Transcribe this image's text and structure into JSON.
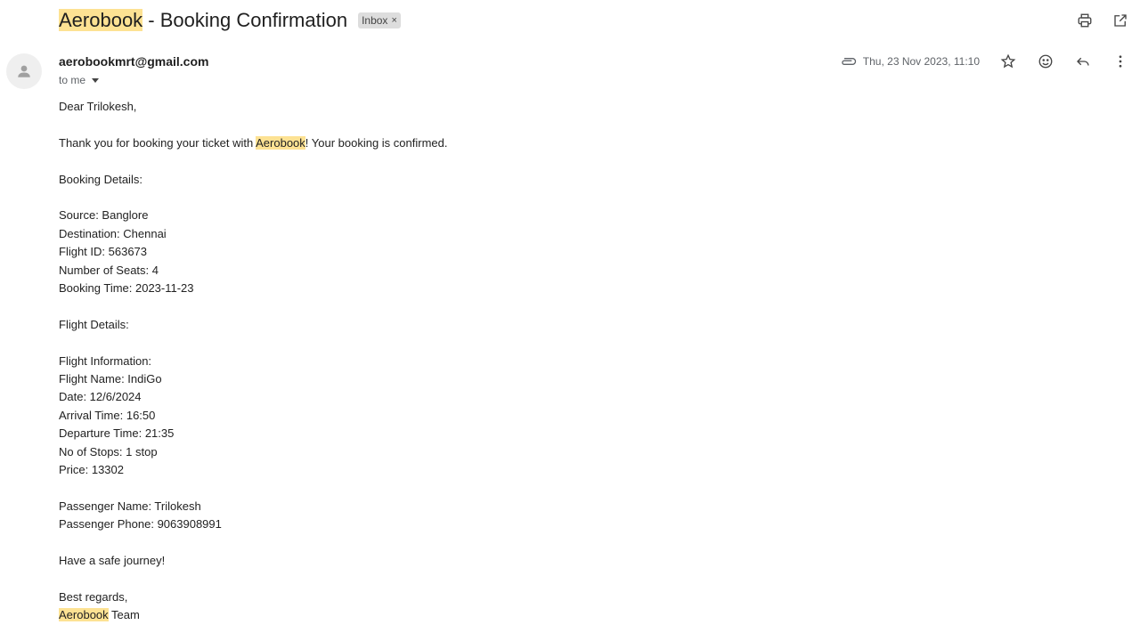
{
  "email": {
    "subject_brand": "Aerobook",
    "subject_rest": " - Booking Confirmation",
    "label_chip": "Inbox",
    "label_chip_close": "×",
    "sender": "aerobookmrt@gmail.com",
    "to_line": "to me",
    "date": "Thu, 23 Nov 2023, 11:10",
    "icons": {
      "print": "print-icon",
      "open_new": "open-in-new-window-icon",
      "attachment": "attachment-icon",
      "star": "star-icon",
      "emoji": "emoji-reaction-icon",
      "reply": "reply-icon",
      "more": "more-options-icon",
      "avatar": "person-avatar-icon"
    },
    "highlight_color": "#fde293"
  },
  "body": {
    "greeting": "Dear Trilokesh,",
    "thanks_pre": "Thank you for booking your ticket with ",
    "thanks_brand": "Aerobook",
    "thanks_post": "! Your booking is confirmed.",
    "booking_heading": "Booking Details:",
    "source": "Source: Banglore",
    "destination": "Destination: Chennai",
    "flight_id": "Flight ID: 563673",
    "seats": "Number of Seats: 4",
    "booking_time": "Booking Time: 2023-11-23",
    "flight_heading": "Flight Details:",
    "flight_info": "Flight Information:",
    "flight_name": "Flight Name: IndiGo",
    "date": "Date: 12/6/2024",
    "arrival": "Arrival Time: 16:50",
    "departure": "Departure Time: 21:35",
    "stops": "No of Stops: 1 stop",
    "price": "Price: 13302",
    "passenger_name": "Passenger Name: Trilokesh",
    "passenger_phone": "Passenger Phone: 9063908991",
    "safe_journey": "Have a safe journey!",
    "regards": "Best regards,",
    "team_brand": "Aerobook",
    "team_rest": " Team"
  }
}
